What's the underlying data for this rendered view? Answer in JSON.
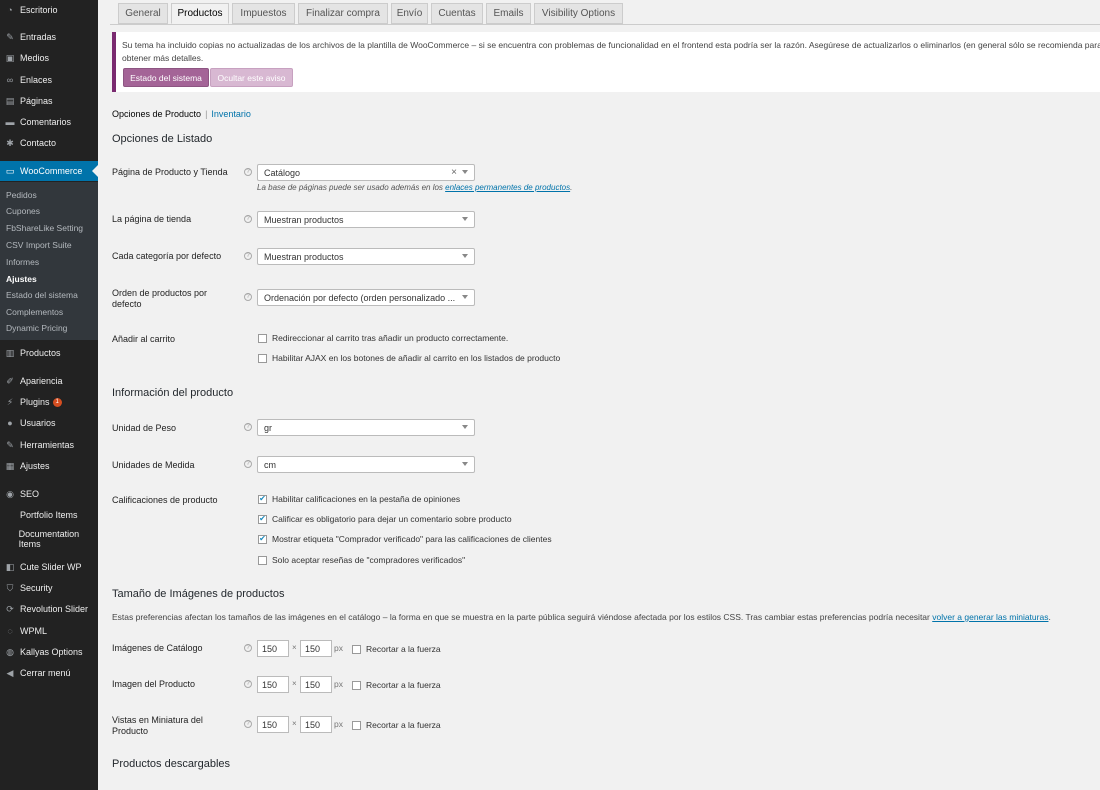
{
  "sidebar": {
    "items": [
      {
        "label": "Escritorio",
        "icon": "dashboard-icon",
        "glyph": "◔"
      },
      {
        "label": "Entradas",
        "icon": "pin-icon",
        "glyph": "✎"
      },
      {
        "label": "Medios",
        "icon": "media-icon",
        "glyph": "▣"
      },
      {
        "label": "Enlaces",
        "icon": "link-icon",
        "glyph": "∞"
      },
      {
        "label": "Páginas",
        "icon": "page-icon",
        "glyph": "▤"
      },
      {
        "label": "Comentarios",
        "icon": "comment-icon",
        "glyph": "▬"
      },
      {
        "label": "Contacto",
        "icon": "gear-icon",
        "glyph": "✱"
      },
      {
        "label": "WooCommerce",
        "icon": "woocommerce-icon",
        "glyph": "▭"
      },
      {
        "label": "Productos",
        "icon": "products-icon",
        "glyph": "▥"
      },
      {
        "label": "Apariencia",
        "icon": "brush-icon",
        "glyph": "✐"
      },
      {
        "label": "Plugins",
        "icon": "plugin-icon",
        "glyph": "⚡",
        "badge": "1"
      },
      {
        "label": "Usuarios",
        "icon": "user-icon",
        "glyph": "●"
      },
      {
        "label": "Herramientas",
        "icon": "wrench-icon",
        "glyph": "✎"
      },
      {
        "label": "Ajustes",
        "icon": "settings-icon",
        "glyph": "▦"
      },
      {
        "label": "SEO",
        "icon": "seo-icon",
        "glyph": "◉"
      },
      {
        "label": "Portfolio Items",
        "icon": "portfolio-icon",
        "glyph": ""
      },
      {
        "label": "Documentation Items",
        "icon": "documentation-icon",
        "glyph": ""
      },
      {
        "label": "Cute Slider WP",
        "icon": "slider-icon",
        "glyph": "◧"
      },
      {
        "label": "Security",
        "icon": "shield-icon",
        "glyph": "⛉"
      },
      {
        "label": "Revolution Slider",
        "icon": "refresh-icon",
        "glyph": "⟳"
      },
      {
        "label": "WPML",
        "icon": "wpml-icon",
        "glyph": "◌"
      },
      {
        "label": "Kallyas Options",
        "icon": "options-icon",
        "glyph": "◍"
      },
      {
        "label": "Cerrar menú",
        "icon": "collapse-icon",
        "glyph": "◀"
      }
    ],
    "submenu": [
      {
        "label": "Pedidos"
      },
      {
        "label": "Cupones"
      },
      {
        "label": "FbShareLike Setting"
      },
      {
        "label": "CSV Import Suite"
      },
      {
        "label": "Informes"
      },
      {
        "label": "Ajustes",
        "current": true
      },
      {
        "label": "Estado del sistema"
      },
      {
        "label": "Complementos"
      },
      {
        "label": "Dynamic Pricing"
      }
    ]
  },
  "tabs": [
    "General",
    "Productos",
    "Impuestos",
    "Finalizar compra",
    "Envío",
    "Cuentas",
    "Emails",
    "Visibility Options"
  ],
  "active_tab": "Productos",
  "notice": {
    "text": "Su tema ha incluido copias no actualizadas de los archivos de la plantilla de WooCommerce – si se encuentra con problemas de funcionalidad en el frontend esta podría ser la razón. Asegúrese de actualizarlos o eliminarlos (en general sólo se recomienda para obtener más detalles.",
    "status_button": "Estado del sistema",
    "hide_button": "Ocultar este aviso",
    "accent_color": "#a46497"
  },
  "subsub": {
    "current": "Opciones de Producto",
    "separator": "|",
    "link": "Inventario"
  },
  "listing": {
    "heading": "Opciones de Listado",
    "shop_page": {
      "label": "Página de Producto y Tienda",
      "value": "Catálogo",
      "clear": "×",
      "desc_prefix": "La base de páginas puede ser usado además en los ",
      "desc_link": "enlaces permanentes de productos",
      "desc_suffix": "."
    },
    "shop_display": {
      "label": "La página de tienda",
      "value": "Muestran productos"
    },
    "category_display": {
      "label": "Cada categoría por defecto",
      "value": "Muestran productos"
    },
    "sorting": {
      "label": "Orden de productos por defecto",
      "value": "Ordenación por defecto (orden personalizado ..."
    },
    "add_to_cart": {
      "label": "Añadir al carrito",
      "options": [
        "Redireccionar al carrito tras añadir un producto correctamente.",
        "Habilitar AJAX en los botones de añadir al carrito en los listados de producto"
      ],
      "checked": [
        false,
        false
      ]
    }
  },
  "product_data": {
    "heading": "Información del producto",
    "weight": {
      "label": "Unidad de Peso",
      "value": "gr"
    },
    "dimensions": {
      "label": "Unidades de Medida",
      "value": "cm"
    },
    "ratings": {
      "label": "Calificaciones de producto",
      "options": [
        "Habilitar calificaciones en la pestaña de opiniones",
        "Calificar es obligatorio para dejar un comentario sobre producto",
        "Mostrar etiqueta \"Comprador verificado\" para las calificaciones de clientes",
        "Solo aceptar reseñas de \"compradores verificados\""
      ],
      "checked": [
        true,
        true,
        true,
        false
      ]
    }
  },
  "images": {
    "heading": "Tamaño de Imágenes de productos",
    "desc": "Estas preferencias afectan los tamaños de las imágenes en el catálogo – la forma en que se muestra en la parte pública seguirá viéndose afectada por los estilos CSS. Tras cambiar estas preferencias podría necesitar ",
    "desc_link": "volver a generar las miniaturas",
    "desc_suffix": ".",
    "rows": [
      {
        "label": "Imágenes de Catálogo",
        "width": "150",
        "height": "150",
        "unit": "px",
        "times": "×",
        "crop_label": "Recortar a la fuerza",
        "crop": false
      },
      {
        "label": "Imagen del Producto",
        "width": "150",
        "height": "150",
        "unit": "px",
        "times": "×",
        "crop_label": "Recortar a la fuerza",
        "crop": false
      },
      {
        "label": "Vistas en Miniatura del Producto",
        "width": "150",
        "height": "150",
        "unit": "px",
        "times": "×",
        "crop_label": "Recortar a la fuerza",
        "crop": false
      }
    ]
  },
  "downloads": {
    "heading": "Productos descargables"
  },
  "help_glyph": "?",
  "check_glyph": "✔"
}
